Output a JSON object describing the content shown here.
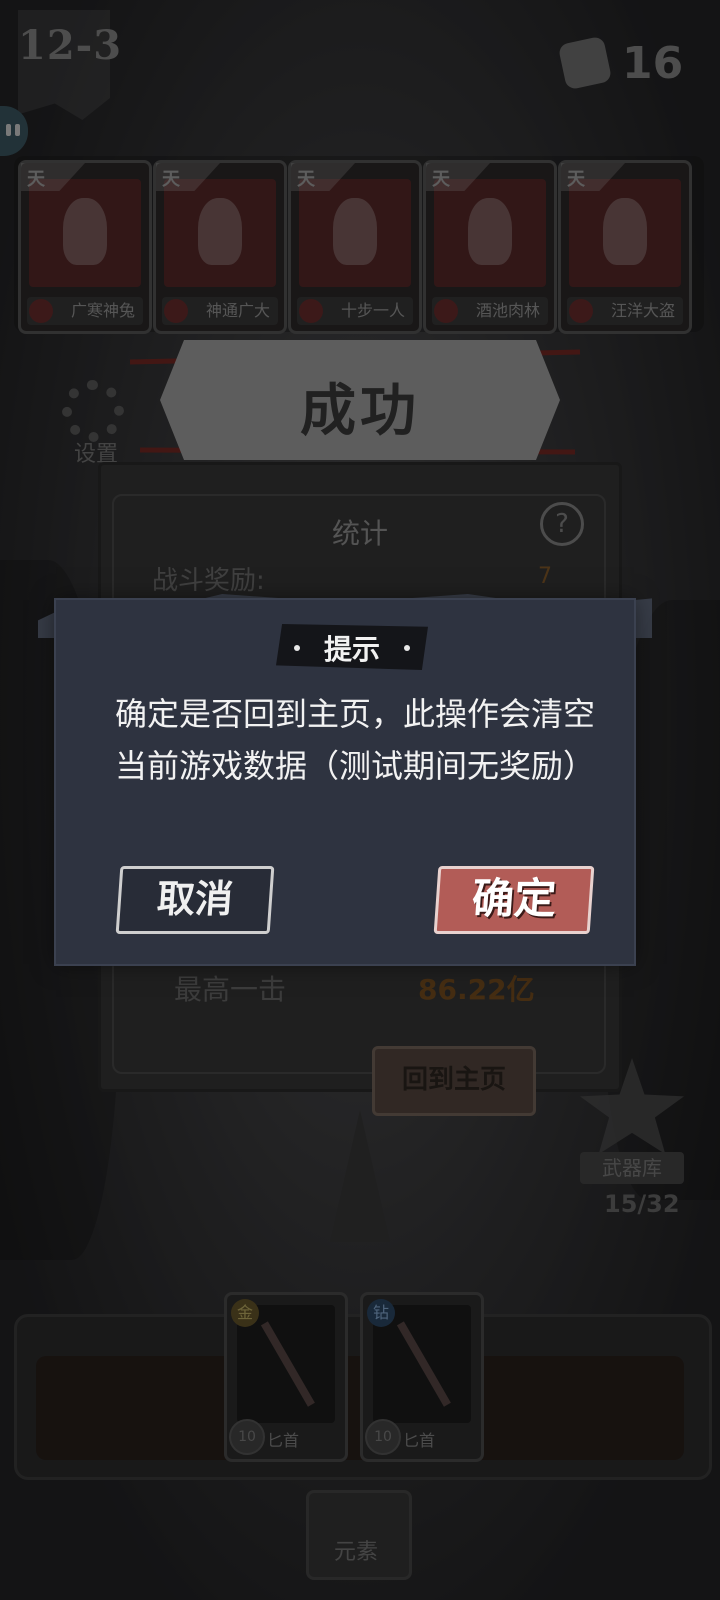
{
  "hud": {
    "level": "12-3",
    "dice_count": "16",
    "settings_label": "设置"
  },
  "heroes": [
    {
      "tier": "天",
      "name": "广寒神兔"
    },
    {
      "tier": "天",
      "name": "神通广大"
    },
    {
      "tier": "天",
      "name": "十步一人"
    },
    {
      "tier": "天",
      "name": "酒池肉林"
    },
    {
      "tier": "天",
      "name": "汪洋大盗"
    }
  ],
  "result": {
    "title": "成功",
    "stats_title": "统计",
    "help_icon": "?",
    "battle_reward_label": "战斗奖励:",
    "battle_reward_value": "7",
    "max_hit_label": "最高一击",
    "max_hit_value": "86.22亿",
    "home_button": "回到主页"
  },
  "weapon_library": {
    "label": "武器库",
    "count": "15/32"
  },
  "weapons": [
    {
      "rarity": "金",
      "level": "10",
      "name": "匕首"
    },
    {
      "rarity": "钻",
      "level": "10",
      "name": "匕首"
    }
  ],
  "bottom": {
    "element_label": "元素"
  },
  "dialog": {
    "title": "提示",
    "message": "确定是否回到主页，此操作会清空当前游戏数据（测试期间无奖励）",
    "cancel": "取消",
    "confirm": "确定"
  },
  "colors": {
    "dialog_bg": "#2e3340",
    "confirm_btn": "#b25c57",
    "reward_value": "#8b5f2c"
  }
}
